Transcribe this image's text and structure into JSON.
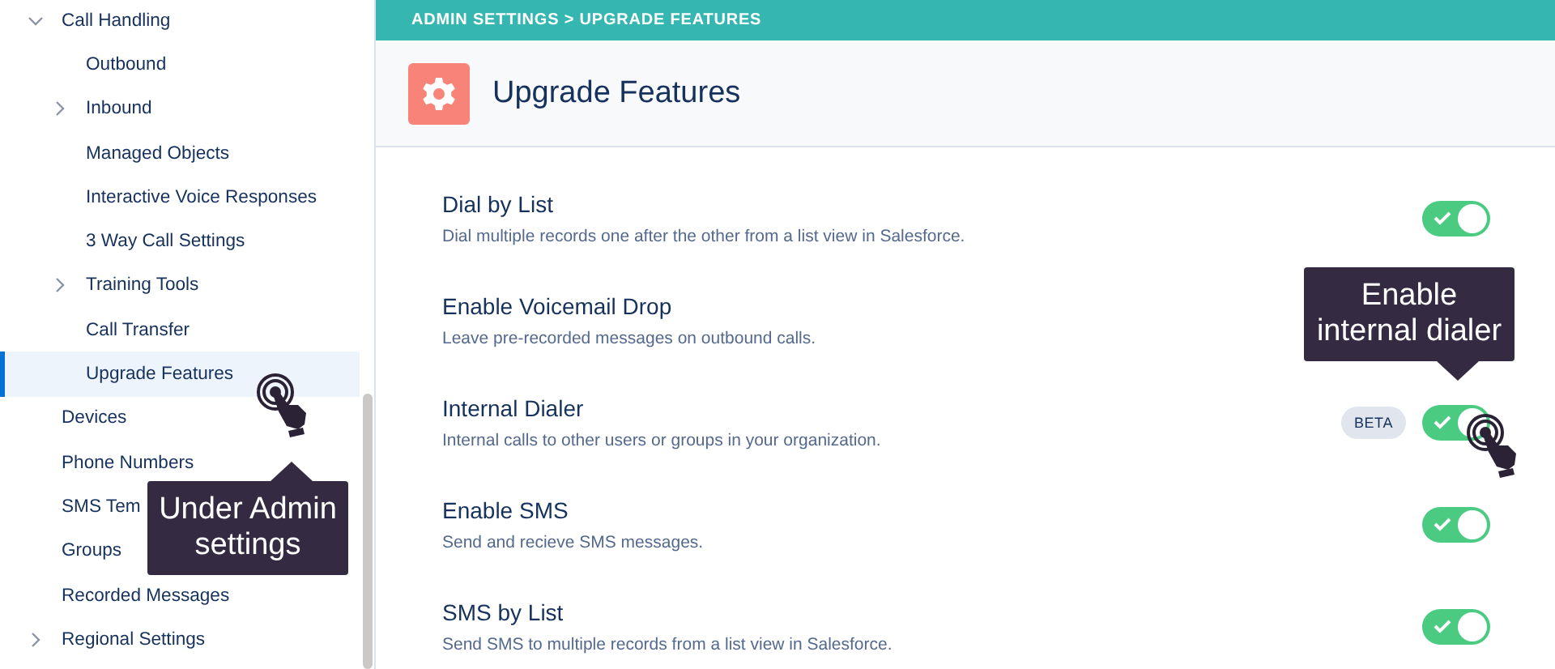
{
  "sidebar": {
    "items": [
      {
        "label": "Call Handling",
        "expanded": true,
        "selected": false,
        "children": [
          {
            "label": "Outbound",
            "selected": false
          },
          {
            "label": "Inbound",
            "expanded": false,
            "selected": false
          },
          {
            "label": "Managed Objects",
            "selected": false
          },
          {
            "label": "Interactive Voice Responses",
            "selected": false
          },
          {
            "label": "3 Way Call Settings",
            "selected": false
          },
          {
            "label": "Training Tools",
            "expanded": false,
            "selected": false
          },
          {
            "label": "Call Transfer",
            "selected": false
          },
          {
            "label": "Upgrade Features",
            "selected": true
          }
        ]
      },
      {
        "label": "Devices",
        "selected": false
      },
      {
        "label": "Phone Numbers",
        "selected": false
      },
      {
        "label": "SMS Tem",
        "selected": false
      },
      {
        "label": "Groups",
        "selected": false
      },
      {
        "label": "Recorded Messages",
        "selected": false
      },
      {
        "label": "Regional Settings",
        "expanded": false,
        "selected": false
      }
    ]
  },
  "breadcrumb": "ADMIN SETTINGS > UPGRADE FEATURES",
  "page_title": "Upgrade Features",
  "features": [
    {
      "title": "Dial by List",
      "description": "Dial multiple records one after the other from a list view in Salesforce.",
      "on": true
    },
    {
      "title": "Enable Voicemail Drop",
      "description": "Leave pre-recorded messages on outbound calls."
    },
    {
      "title": "Internal Dialer",
      "description": "Internal calls to other users or groups in your organization.",
      "badge": "BETA",
      "on": true
    },
    {
      "title": "Enable SMS",
      "description": "Send and recieve SMS messages.",
      "on": true
    },
    {
      "title": "SMS by List",
      "description": "Send SMS to multiple records from a list view in Salesforce.",
      "on": true
    }
  ],
  "callouts": [
    {
      "text": "Under Admin settings"
    },
    {
      "text": "Enable internal dialer"
    }
  ]
}
